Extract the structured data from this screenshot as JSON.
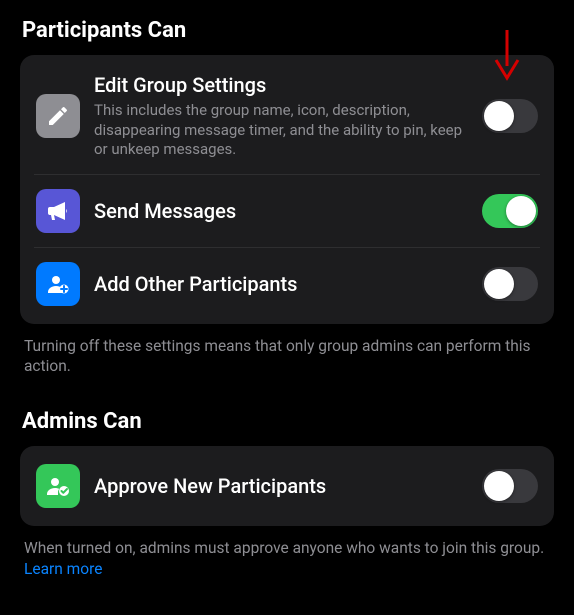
{
  "participants_section": {
    "title": "Participants Can",
    "rows": [
      {
        "icon_name": "pencil-icon",
        "title": "Edit Group Settings",
        "subtitle": "This includes the group name, icon, description, disappearing message timer, and the ability to pin, keep or unkeep messages.",
        "toggle": false
      },
      {
        "icon_name": "megaphone-icon",
        "title": "Send Messages",
        "toggle": true
      },
      {
        "icon_name": "add-person-icon",
        "title": "Add Other Participants",
        "toggle": false
      }
    ],
    "footer": "Turning off these settings means that only group admins can perform this action."
  },
  "admins_section": {
    "title": "Admins Can",
    "rows": [
      {
        "icon_name": "approve-icon",
        "title": "Approve New Participants",
        "toggle": false
      }
    ],
    "footer": "When turned on, admins must approve anyone who wants to join this group. ",
    "learn_more": "Learn more"
  }
}
